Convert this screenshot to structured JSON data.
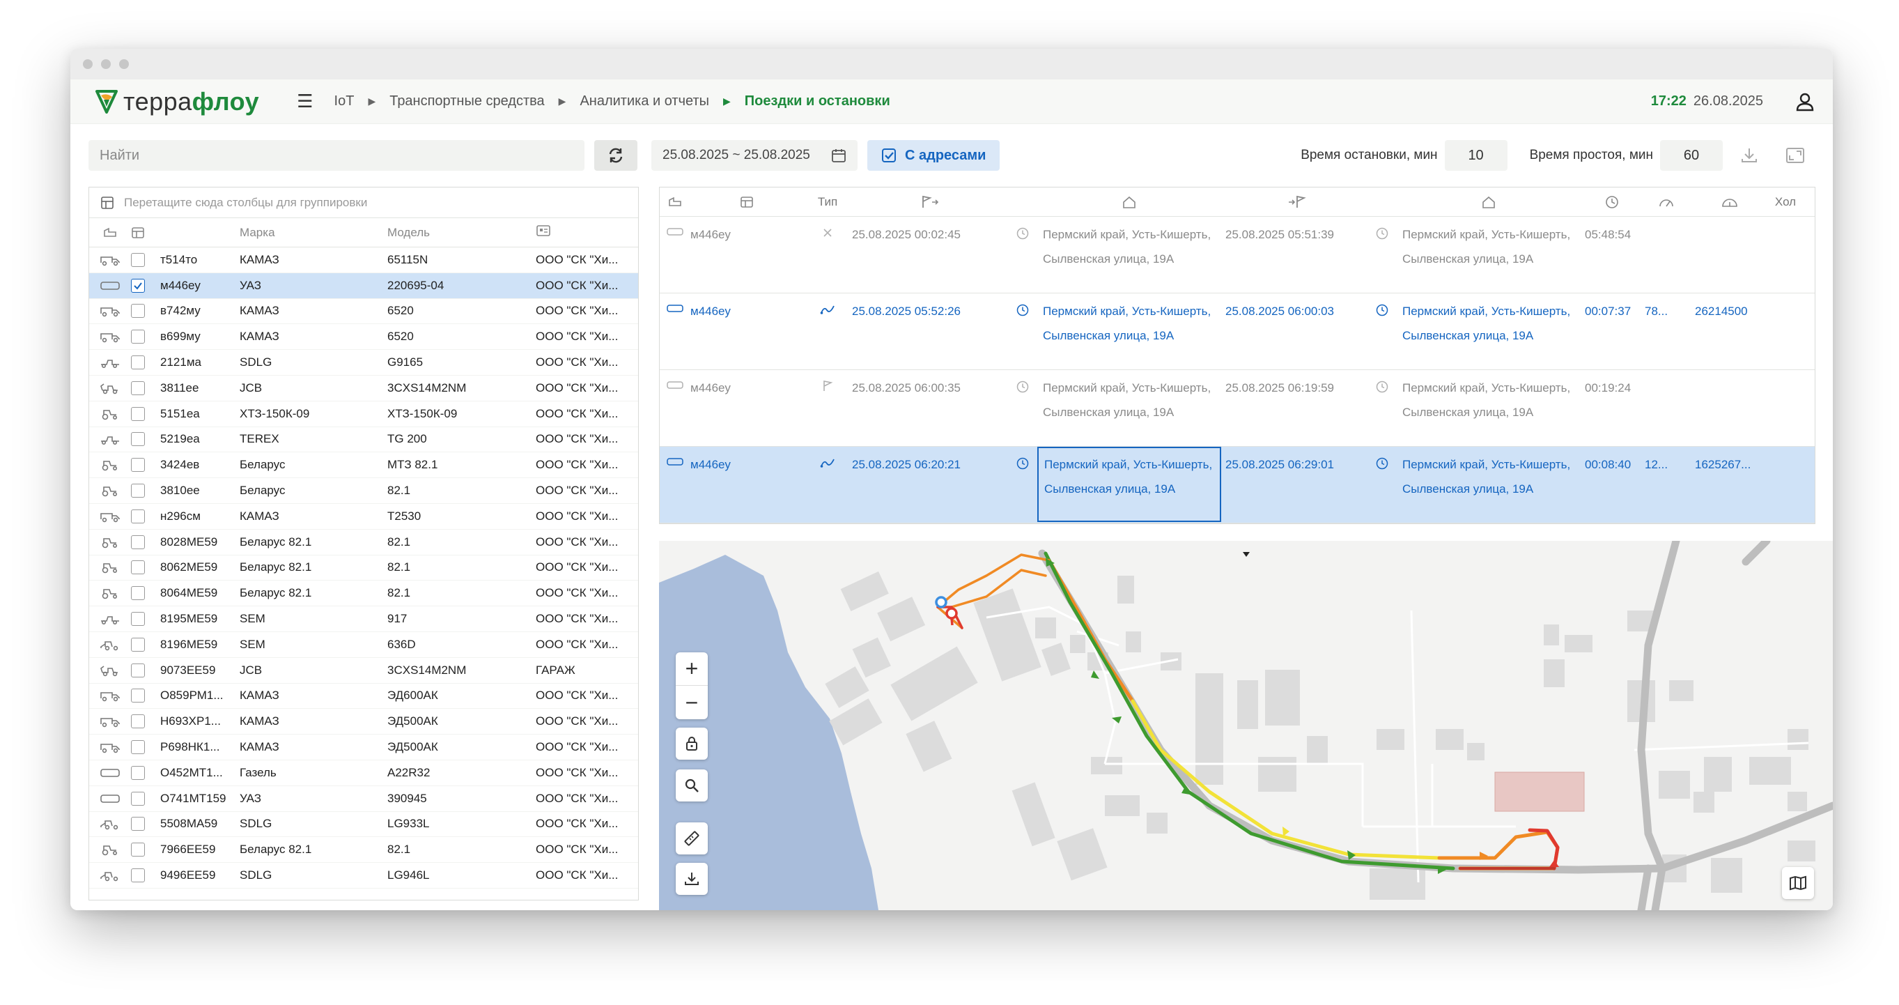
{
  "app": {
    "logo_a": "терра",
    "logo_b": "флоу",
    "breadcrumbs": [
      "IoT",
      "Транспортные средства",
      "Аналитика и отчеты",
      "Поездки и остановки"
    ],
    "time": "17:22",
    "date": "26.08.2025"
  },
  "toolbar": {
    "search_placeholder": "Найти",
    "date_range": "25.08.2025 ~ 25.08.2025",
    "with_addresses": "С адресами",
    "stop_time_label": "Время остановки, мин",
    "stop_time_value": "10",
    "idle_time_label": "Время простоя, мин",
    "idle_time_value": "60"
  },
  "vehicles": {
    "group_hint": "Перетащите сюда столбцы для группировки",
    "columns": [
      "Марка",
      "Модель"
    ],
    "rows": [
      {
        "num": "т514то",
        "brand": "КАМАЗ",
        "model": "65115N",
        "org": "ООО \"СК \"Хи...",
        "icon": "truck-icon",
        "checked": false
      },
      {
        "num": "м446еу",
        "brand": "УАЗ",
        "model": "220695-04",
        "org": "ООО \"СК \"Хи...",
        "icon": "van-icon",
        "checked": true
      },
      {
        "num": "в742му",
        "brand": "КАМАЗ",
        "model": "6520",
        "org": "ООО \"СК \"Хи...",
        "icon": "truck-icon",
        "checked": false
      },
      {
        "num": "в699му",
        "brand": "КАМАЗ",
        "model": "6520",
        "org": "ООО \"СК \"Хи...",
        "icon": "truck-icon",
        "checked": false
      },
      {
        "num": "2121ма",
        "brand": "SDLG",
        "model": "G9165",
        "org": "ООО \"СК \"Хи...",
        "icon": "grader-icon",
        "checked": false
      },
      {
        "num": "3811ее",
        "brand": "JCB",
        "model": "3CXS14M2NM",
        "org": "ООО \"СК \"Хи...",
        "icon": "backhoe-icon",
        "checked": false
      },
      {
        "num": "5151еа",
        "brand": "ХТЗ-150К-09",
        "model": "ХТЗ-150К-09",
        "org": "ООО \"СК \"Хи...",
        "icon": "tractor-icon",
        "checked": false
      },
      {
        "num": "5219еа",
        "brand": "TEREX",
        "model": "TG 200",
        "org": "ООО \"СК \"Хи...",
        "icon": "grader-icon",
        "checked": false
      },
      {
        "num": "3424ев",
        "brand": "Беларус",
        "model": "МТЗ 82.1",
        "org": "ООО \"СК \"Хи...",
        "icon": "tractor-icon",
        "checked": false
      },
      {
        "num": "3810ее",
        "brand": "Беларус",
        "model": "82.1",
        "org": "ООО \"СК \"Хи...",
        "icon": "tractor-icon",
        "checked": false
      },
      {
        "num": "н296см",
        "brand": "КАМАЗ",
        "model": "Т2530",
        "org": "ООО \"СК \"Хи...",
        "icon": "truck-icon",
        "checked": false
      },
      {
        "num": "8028МЕ59",
        "brand": "Беларус 82.1",
        "model": "82.1",
        "org": "ООО \"СК \"Хи...",
        "icon": "tractor-icon",
        "checked": false
      },
      {
        "num": "8062МЕ59",
        "brand": "Беларус 82.1",
        "model": "82.1",
        "org": "ООО \"СК \"Хи...",
        "icon": "tractor-icon",
        "checked": false
      },
      {
        "num": "8064МЕ59",
        "brand": "Беларус 82.1",
        "model": "82.1",
        "org": "ООО \"СК \"Хи...",
        "icon": "tractor-icon",
        "checked": false
      },
      {
        "num": "8195МЕ59",
        "brand": "SEM",
        "model": "917",
        "org": "ООО \"СК \"Хи...",
        "icon": "grader-icon",
        "checked": false
      },
      {
        "num": "8196МЕ59",
        "brand": "SEM",
        "model": "636D",
        "org": "ООО \"СК \"Хи...",
        "icon": "loader-icon",
        "checked": false
      },
      {
        "num": "9073ЕЕ59",
        "brand": "JCB",
        "model": "3CXS14M2NM",
        "org": "ГАРАЖ",
        "icon": "backhoe-icon",
        "checked": false
      },
      {
        "num": "О859РМ1...",
        "brand": "КАМАЗ",
        "model": "ЭД600АК",
        "org": "ООО \"СК \"Хи...",
        "icon": "truck-icon",
        "checked": false
      },
      {
        "num": "Н693ХР1...",
        "brand": "КАМАЗ",
        "model": "ЭД500АК",
        "org": "ООО \"СК \"Хи...",
        "icon": "truck-icon",
        "checked": false
      },
      {
        "num": "Р698НК1...",
        "brand": "КАМАЗ",
        "model": "ЭД500АК",
        "org": "ООО \"СК \"Хи...",
        "icon": "truck-icon",
        "checked": false
      },
      {
        "num": "О452МТ1...",
        "brand": "Газель",
        "model": "А22R32",
        "org": "ООО \"СК \"Хи...",
        "icon": "van-icon",
        "checked": false
      },
      {
        "num": "О741МТ159",
        "brand": "УАЗ",
        "model": "390945",
        "org": "ООО \"СК \"Хи...",
        "icon": "van-icon",
        "checked": false
      },
      {
        "num": "5508МА59",
        "brand": "SDLG",
        "model": "LG933L",
        "org": "ООО \"СК \"Хи...",
        "icon": "loader-icon",
        "checked": false
      },
      {
        "num": "7966ЕЕ59",
        "brand": "Беларус 82.1",
        "model": "82.1",
        "org": "ООО \"СК \"Хи...",
        "icon": "tractor-icon",
        "checked": false
      },
      {
        "num": "9496ЕЕ59",
        "brand": "SDLG",
        "model": "LG946L",
        "org": "ООО \"СК \"Хи...",
        "icon": "loader-icon",
        "checked": false
      }
    ]
  },
  "trips": {
    "type_label": "Тип",
    "last_label": "Хол",
    "rows": [
      {
        "vehicle": "м446еу",
        "kind": "stop",
        "start": "25.08.2025 00:02:45",
        "start_addr": "Пермский край, Усть-Кишерть, Сылвенская улица, 19А",
        "end": "25.08.2025 05:51:39",
        "end_addr": "Пермский край, Усть-Кишерть, Сылвенская улица, 19А",
        "duration": "05:48:54",
        "c1": "",
        "c2": ""
      },
      {
        "vehicle": "м446еу",
        "kind": "trip",
        "start": "25.08.2025 05:52:26",
        "start_addr": "Пермский край, Усть-Кишерть, Сылвенская улица, 19А",
        "end": "25.08.2025 06:00:03",
        "end_addr": "Пермский край, Усть-Кишерть, Сылвенская улица, 19А",
        "duration": "00:07:37",
        "c1": "78...",
        "c2": "26214500"
      },
      {
        "vehicle": "м446еу",
        "kind": "idle",
        "start": "25.08.2025 06:00:35",
        "start_addr": "Пермский край, Усть-Кишерть, Сылвенская улица, 19А",
        "end": "25.08.2025 06:19:59",
        "end_addr": "Пермский край, Усть-Кишерть, Сылвенская улица, 19А",
        "duration": "00:19:24",
        "c1": "",
        "c2": ""
      },
      {
        "vehicle": "м446еу",
        "kind": "trip",
        "start": "25.08.2025 06:20:21",
        "start_addr": "Пермский край, Усть-Кишерть, Сылвенская улица, 19А",
        "end": "25.08.2025 06:29:01",
        "end_addr": "Пермский край, Усть-Кишерть, Сылвенская улица, 19А",
        "duration": "00:08:40",
        "c1": "12...",
        "c2": "1625267..."
      }
    ]
  },
  "colors": {
    "brand_green": "#1e8a3c",
    "accent_blue": "#1565c0",
    "selected_row": "#cfe2f7",
    "water": "#a9bddb",
    "route_green": "#3e9b2f",
    "route_yellow": "#f2e238",
    "route_orange": "#f08a24",
    "route_red": "#e03a2f"
  }
}
